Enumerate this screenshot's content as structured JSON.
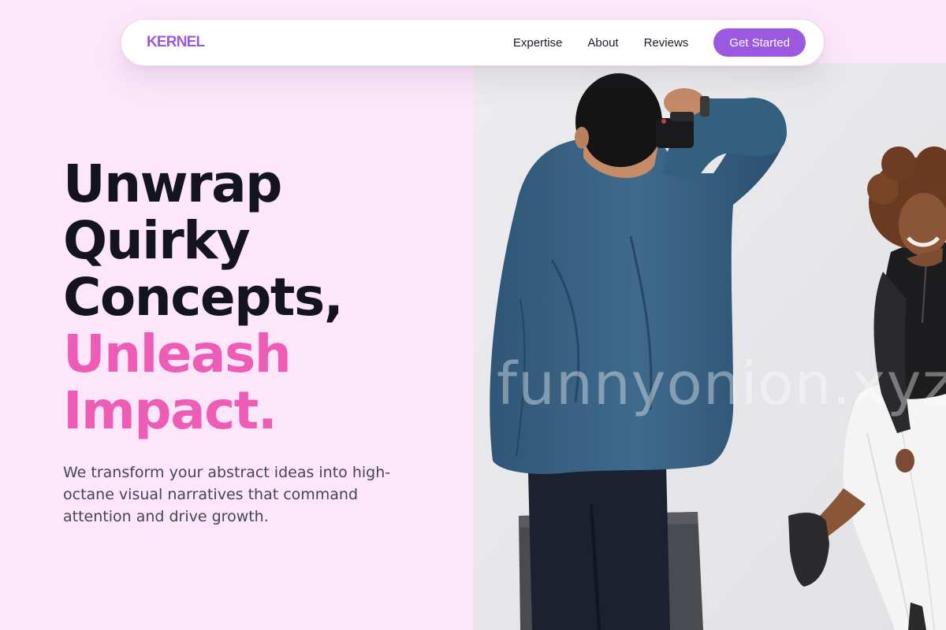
{
  "nav": {
    "logo": "KERNEL",
    "links": [
      "Expertise",
      "About",
      "Reviews"
    ],
    "cta_label": "Get Started"
  },
  "hero": {
    "headline_lines": [
      "Unwrap",
      "Quirky",
      "Concepts,"
    ],
    "headline_accent_lines": [
      "Unleash",
      "Impact."
    ],
    "subtext": "We transform your abstract ideas into high-octane visual narratives that command attention and drive growth.",
    "watermark": "funnyonion.xyz"
  },
  "colors": {
    "background": "#fde6fa",
    "brand_purple": "#9b59e0",
    "accent_pink": "#ee5db5",
    "headline_dark": "#13141f",
    "body_text": "#454559"
  },
  "icons": {
    "photo": "photographer-shooting-model-image"
  }
}
